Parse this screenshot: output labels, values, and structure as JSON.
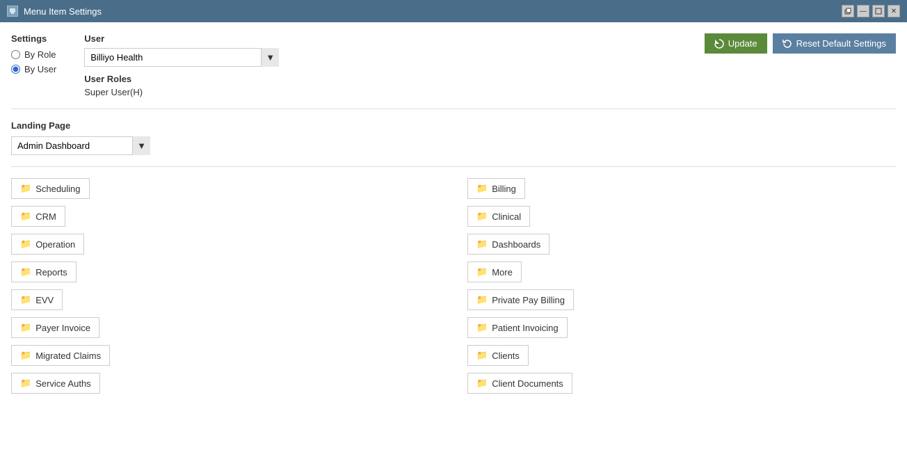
{
  "titleBar": {
    "title": "Menu Item Settings",
    "controls": [
      "minimize",
      "maximize",
      "close"
    ]
  },
  "settings": {
    "label": "Settings",
    "options": [
      {
        "id": "by-role",
        "label": "By Role",
        "checked": false
      },
      {
        "id": "by-user",
        "label": "By User",
        "checked": true
      }
    ]
  },
  "user": {
    "label": "User",
    "value": "Billiyo Health",
    "options": [
      "Billiyo Health"
    ]
  },
  "userRoles": {
    "label": "User Roles",
    "value": "Super User(H)"
  },
  "buttons": {
    "update": "Update",
    "resetDefault": "Reset Default Settings"
  },
  "landingPage": {
    "label": "Landing Page",
    "value": "Admin Dashboard",
    "options": [
      "Admin Dashboard"
    ]
  },
  "menuItems": {
    "left": [
      "Scheduling",
      "CRM",
      "Operation",
      "Reports",
      "EVV",
      "Payer Invoice",
      "Migrated Claims",
      "Service Auths"
    ],
    "right": [
      "Billing",
      "Clinical",
      "Dashboards",
      "More",
      "Private Pay Billing",
      "Patient Invoicing",
      "Clients",
      "Client Documents"
    ]
  }
}
